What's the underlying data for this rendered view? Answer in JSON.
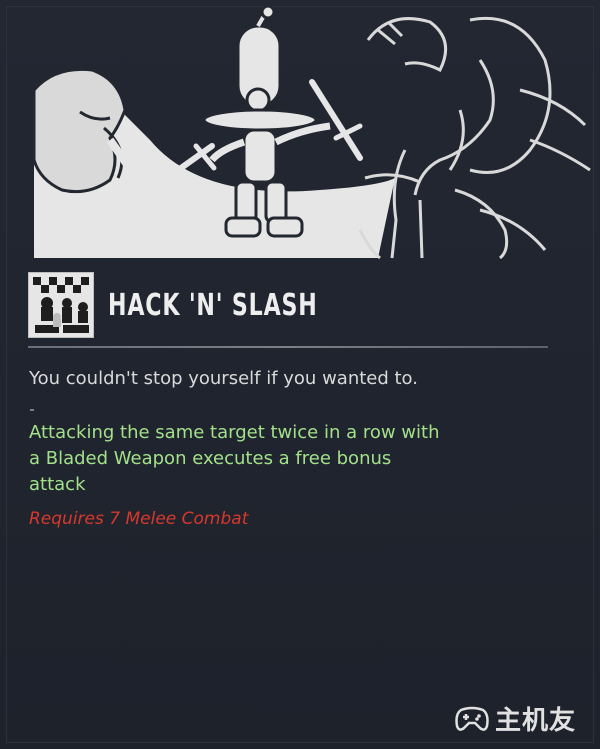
{
  "perk": {
    "title": "HACK 'N' SLASH",
    "flavor": "You couldn't stop yourself if you wanted to.",
    "effect_lines": [
      "Attacking the same target twice in a row with",
      "a Bladed Weapon executes a free bonus",
      "attack"
    ],
    "requirement": "Requires 7 Melee Combat"
  },
  "watermark": {
    "text": "主机友",
    "icon": "gamepad-icon"
  },
  "colors": {
    "background": "#21252f",
    "illustration": "#e6e6e6",
    "effect_text": "#a3e08a",
    "requirement_text": "#d9382d",
    "flavor_text": "#d9d9d9"
  }
}
